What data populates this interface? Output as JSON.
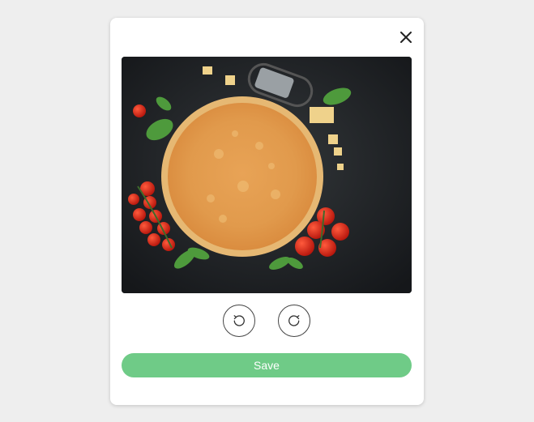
{
  "modal": {
    "close_icon": "close-icon",
    "image": {
      "subject": "pizza-photo"
    },
    "rotate_left_icon": "rotate-counterclockwise-icon",
    "rotate_right_icon": "rotate-clockwise-icon",
    "save_label": "Save"
  },
  "colors": {
    "page_background": "#eeeeee",
    "modal_background": "#ffffff",
    "save_button": "#6fcb87",
    "save_text": "#ffffff",
    "icon_stroke": "#444444"
  }
}
